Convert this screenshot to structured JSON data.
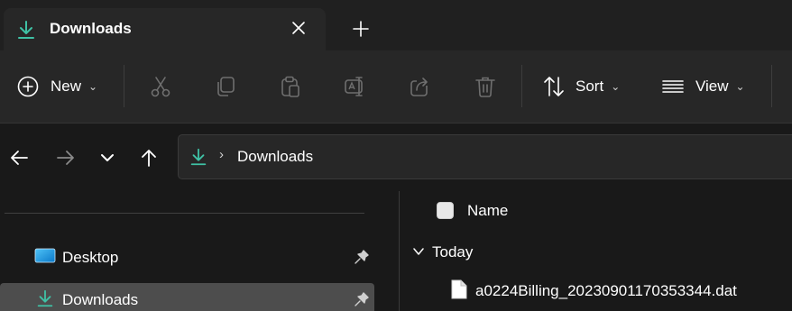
{
  "window": {
    "tab_title": "Downloads",
    "tab_icon": "download-arrow-icon",
    "close_icon": "close-icon",
    "new_tab_icon": "plus-icon"
  },
  "toolbar": {
    "new_label": "New",
    "sort_label": "Sort",
    "view_label": "View",
    "chevron": "⌄",
    "icons": [
      "plus-circle-icon",
      "cut-icon",
      "copy-icon",
      "paste-icon",
      "rename-icon",
      "share-icon",
      "delete-icon",
      "sort-icon",
      "view-icon"
    ]
  },
  "address_bar": {
    "separator": "›",
    "path": "Downloads"
  },
  "navigation_pane": {
    "items": [
      {
        "label": "Desktop",
        "icon": "desktop-folder-icon",
        "pinned": true,
        "selected": false
      },
      {
        "label": "Downloads",
        "icon": "download-arrow-icon",
        "pinned": true,
        "selected": true
      }
    ]
  },
  "file_list": {
    "column_name": "Name",
    "group_label": "Today",
    "files": [
      {
        "name": "a0224Billing_20230901170353344.dat",
        "icon": "file-icon"
      }
    ]
  },
  "colors": {
    "accent_green": "#3fc1a5",
    "titlebar_bg": "#202020",
    "toolbar_bg": "#272727",
    "window_bg": "#191919",
    "selected_bg": "#4d4d4d",
    "disabled_icon": "#6f6f6f"
  }
}
